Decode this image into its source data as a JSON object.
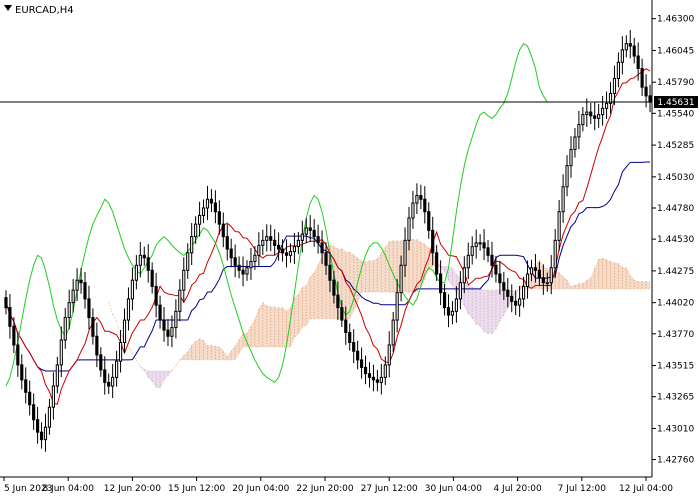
{
  "chart_data": {
    "type": "candlestick",
    "symbol_label": "EURCAD,H4",
    "current_price_label": "1.45631",
    "current_price": 1.45631,
    "ylim": [
      1.4262,
      1.4645
    ],
    "y_ticks": [
      "1.46300",
      "1.46045",
      "1.45790",
      "1.45540",
      "1.45285",
      "1.45030",
      "1.44780",
      "1.44530",
      "1.44275",
      "1.44020",
      "1.43770",
      "1.43515",
      "1.43265",
      "1.43010",
      "1.42760"
    ],
    "x_ticks": [
      "5 Jun 2023",
      "8 Jun 04:00",
      "12 Jun 20:00",
      "15 Jun 12:00",
      "20 Jun 04:00",
      "22 Jun 20:00",
      "27 Jun 12:00",
      "30 Jun 04:00",
      "4 Jul 20:00",
      "7 Jul 12:00",
      "12 Jul 04:00"
    ],
    "colors": {
      "background": "#ffffff",
      "candle": "#000000",
      "tenkan": "#cc0000",
      "kijun": "#00008b",
      "chikou": "#22cc22",
      "cloud_bear": "#c8a0c8",
      "cloud_bull": "#e39a6a",
      "price_line": "#000000",
      "price_label_bg": "#000000",
      "price_label_text": "#ffffff"
    },
    "close": [
      1.4398,
      1.4383,
      1.4368,
      1.4352,
      1.434,
      1.433,
      1.432,
      1.4308,
      1.4298,
      1.4292,
      1.4302,
      1.4318,
      1.4335,
      1.4352,
      1.4372,
      1.439,
      1.4402,
      1.4412,
      1.442,
      1.4418,
      1.4405,
      1.439,
      1.4375,
      1.436,
      1.4348,
      1.4338,
      1.4335,
      1.4342,
      1.4355,
      1.437,
      1.4388,
      1.4405,
      1.442,
      1.4432,
      1.444,
      1.4438,
      1.4428,
      1.4415,
      1.44,
      1.4388,
      1.438,
      1.4375,
      1.4382,
      1.4395,
      1.4412,
      1.4428,
      1.4442,
      1.4455,
      1.4465,
      1.4472,
      1.4478,
      1.4485,
      1.4482,
      1.4475,
      1.4465,
      1.4455,
      1.4445,
      1.4438,
      1.4432,
      1.4428,
      1.4425,
      1.443,
      1.4435,
      1.444,
      1.4448,
      1.4452,
      1.4455,
      1.4452,
      1.4448,
      1.4445,
      1.4442,
      1.444,
      1.4443,
      1.4447,
      1.4452,
      1.4457,
      1.4462,
      1.446,
      1.4455,
      1.445,
      1.4442,
      1.4432,
      1.442,
      1.4408,
      1.4398,
      1.4388,
      1.4378,
      1.437,
      1.4363,
      1.4356,
      1.435,
      1.4345,
      1.4342,
      1.434,
      1.4338,
      1.4342,
      1.4352,
      1.4368,
      1.4388,
      1.441,
      1.4432,
      1.4452,
      1.447,
      1.4482,
      1.4488,
      1.4485,
      1.4475,
      1.446,
      1.4442,
      1.4425,
      1.441,
      1.4398,
      1.4392,
      1.4395,
      1.4405,
      1.4418,
      1.443,
      1.444,
      1.4447,
      1.445,
      1.445,
      1.4446,
      1.444,
      1.4432,
      1.4425,
      1.4418,
      1.4412,
      1.4407,
      1.4403,
      1.44,
      1.4405,
      1.4415,
      1.4425,
      1.443,
      1.4428,
      1.4422,
      1.4418,
      1.4418,
      1.443,
      1.4452,
      1.4475,
      1.4495,
      1.4512,
      1.4525,
      1.4535,
      1.4545,
      1.4553,
      1.4555,
      1.4552,
      1.455,
      1.4553,
      1.4558,
      1.4562,
      1.457,
      1.4582,
      1.4595,
      1.4605,
      1.461,
      1.4608,
      1.46,
      1.459,
      1.4575,
      1.4568,
      1.4563
    ]
  }
}
